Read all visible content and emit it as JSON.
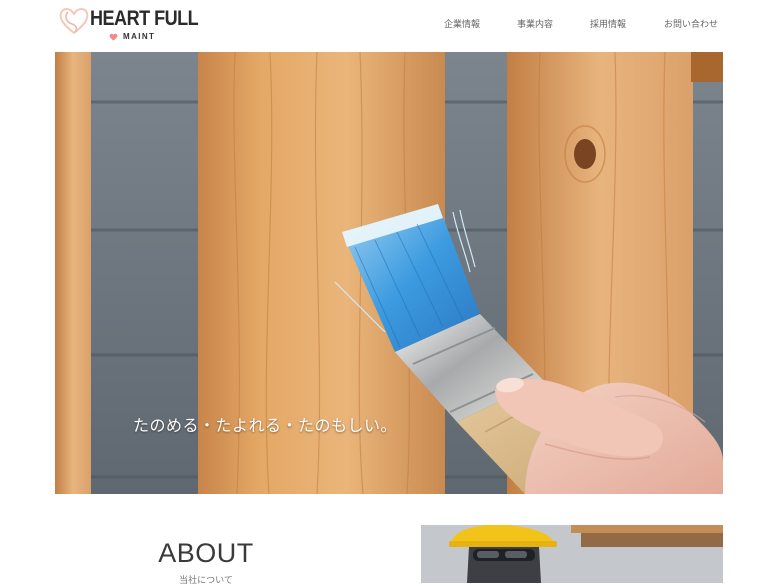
{
  "header": {
    "logo": {
      "brand": "HEART FULL",
      "sub": "MAINT",
      "heart_color": "#f08a8a",
      "mark_color": "#f3c9b8"
    },
    "nav": [
      {
        "label": "企業情報"
      },
      {
        "label": "事業内容"
      },
      {
        "label": "採用情報"
      },
      {
        "label": "お問い合わせ"
      }
    ]
  },
  "hero": {
    "tagline": "たのめる・たよれる・たのもしい。",
    "image": "paintbrush-on-wood-fence"
  },
  "about": {
    "title": "ABOUT",
    "subtitle": "当社について",
    "image": "worker-in-hard-hat"
  }
}
